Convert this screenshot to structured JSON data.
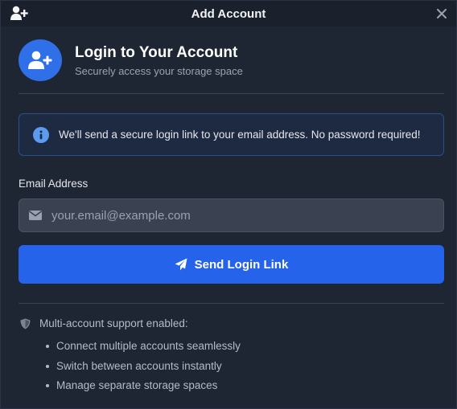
{
  "window": {
    "title": "Add Account",
    "close_symbol": "×",
    "icons": {
      "app": "user-plus-icon",
      "close": "close-icon"
    }
  },
  "header": {
    "title": "Login to Your Account",
    "subtitle": "Securely access your storage space",
    "icon": "user-plus-icon"
  },
  "notice": {
    "icon": "info-circle-icon",
    "text": "We'll send a secure login link to your email address. No password required!"
  },
  "form": {
    "email_label": "Email Address",
    "email_placeholder": "your.email@example.com",
    "email_value": "",
    "email_icon": "envelope-icon",
    "submit_label": "Send Login Link",
    "submit_icon": "paper-plane-icon"
  },
  "features": {
    "icon": "shield-icon",
    "title": "Multi-account support enabled:",
    "items": [
      "Connect multiple accounts seamlessly",
      "Switch between accounts instantly",
      "Manage separate storage spaces"
    ]
  },
  "colors": {
    "background": "#1e2533",
    "titlebar": "#1a202c",
    "accent": "#2563eb",
    "avatar": "#2f6fe8",
    "notice_border": "#2c4f8a",
    "info": "#5b9bf0"
  }
}
